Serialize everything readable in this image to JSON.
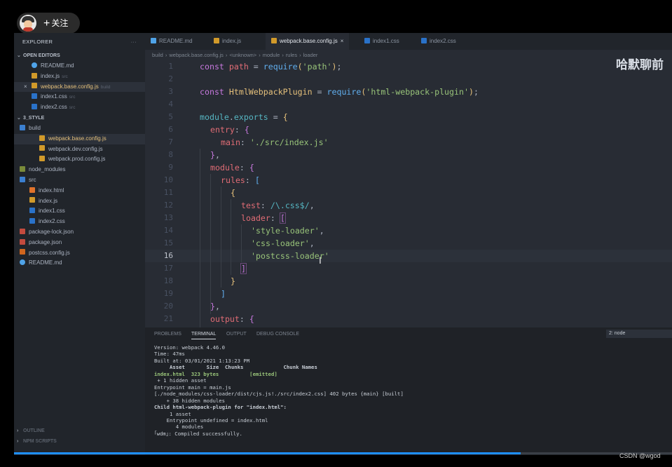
{
  "overlay": {
    "follow_label": "关注",
    "title": "哈默聊前",
    "watermark": "CSDN @wgod",
    "progress": 0.77
  },
  "sidebar": {
    "header": "EXPLORER",
    "more": "···",
    "open_editors_title": "OPEN EDITORS",
    "open_editors": [
      {
        "label": "README.md",
        "icon": "info-icon",
        "sub": ""
      },
      {
        "label": "index.js",
        "icon": "js-file-icon",
        "sub": "src"
      },
      {
        "label": "webpack.base.config.js",
        "icon": "js-file-icon",
        "sub": "build"
      },
      {
        "label": "index1.css",
        "icon": "css-file-icon",
        "sub": "src"
      },
      {
        "label": "index2.css",
        "icon": "css-file-icon",
        "sub": "src"
      }
    ],
    "project_title": "3_STYLE",
    "tree": [
      {
        "label": "build",
        "icon": "folder-icon"
      },
      {
        "label": "webpack.base.config.js",
        "icon": "js-file-icon"
      },
      {
        "label": "webpack.dev.config.js",
        "icon": "js-file-icon"
      },
      {
        "label": "webpack.prod.config.js",
        "icon": "js-file-icon"
      },
      {
        "label": "node_modules",
        "icon": "node-folder-icon"
      },
      {
        "label": "src",
        "icon": "folder-icon"
      },
      {
        "label": "index.html",
        "icon": "html-file-icon"
      },
      {
        "label": "index.js",
        "icon": "js-file-icon"
      },
      {
        "label": "index1.css",
        "icon": "css-file-icon"
      },
      {
        "label": "index2.css",
        "icon": "css-file-icon"
      },
      {
        "label": "package-lock.json",
        "icon": "json-file-icon"
      },
      {
        "label": "package.json",
        "icon": "json-file-icon"
      },
      {
        "label": "postcss.config.js",
        "icon": "postcss-file-icon"
      },
      {
        "label": "README.md",
        "icon": "info-icon"
      }
    ],
    "outline": "OUTLINE",
    "npm_scripts": "NPM SCRIPTS"
  },
  "tabs": [
    {
      "label": "README.md",
      "icon": "info-icon"
    },
    {
      "label": "index.js",
      "icon": "js-file-icon"
    },
    {
      "label": "webpack.base.config.js",
      "icon": "js-file-icon",
      "close": "×"
    },
    {
      "label": "index1.css",
      "icon": "css-file-icon"
    },
    {
      "label": "index2.css",
      "icon": "css-file-icon"
    }
  ],
  "breadcrumb": [
    "build",
    "webpack.base.config.js",
    "<unknown>",
    "module",
    "rules",
    "loader"
  ],
  "editor": {
    "line_numbers": [
      "1",
      "2",
      "3",
      "4",
      "5",
      "6",
      "7",
      "8",
      "9",
      "10",
      "11",
      "12",
      "13",
      "14",
      "15",
      "16",
      "17",
      "18",
      "19",
      "20",
      "21"
    ],
    "current_line": "16"
  },
  "panel": {
    "tabs": [
      "PROBLEMS",
      "TERMINAL",
      "OUTPUT",
      "DEBUG CONSOLE"
    ],
    "terminal_select": "2: node",
    "terminal_lines": [
      "Version: webpack 4.46.0",
      "Time: 47ms",
      "Built at: 03/01/2021 1:13:23 PM",
      "     Asset       Size  Chunks             Chunk Names",
      "index.html  323 bytes          [emitted]",
      " + 1 hidden asset",
      "Entrypoint main = main.js",
      "[./node_modules/css-loader/dist/cjs.js!./src/index2.css] 402 bytes {main} [built]",
      "    + 38 hidden modules",
      "Child html-webpack-plugin for \"index.html\":",
      "     1 asset",
      "    Entrypoint undefined = index.html",
      "       4 modules",
      "｢wdm｣: Compiled successfully."
    ]
  },
  "colors": {
    "sidebar_bg": "#21252b",
    "editor_bg": "#282c34",
    "keyword": "#c678dd",
    "function": "#61afef",
    "string": "#98c379",
    "variable": "#e06c75",
    "accent": "#1e90ff"
  }
}
